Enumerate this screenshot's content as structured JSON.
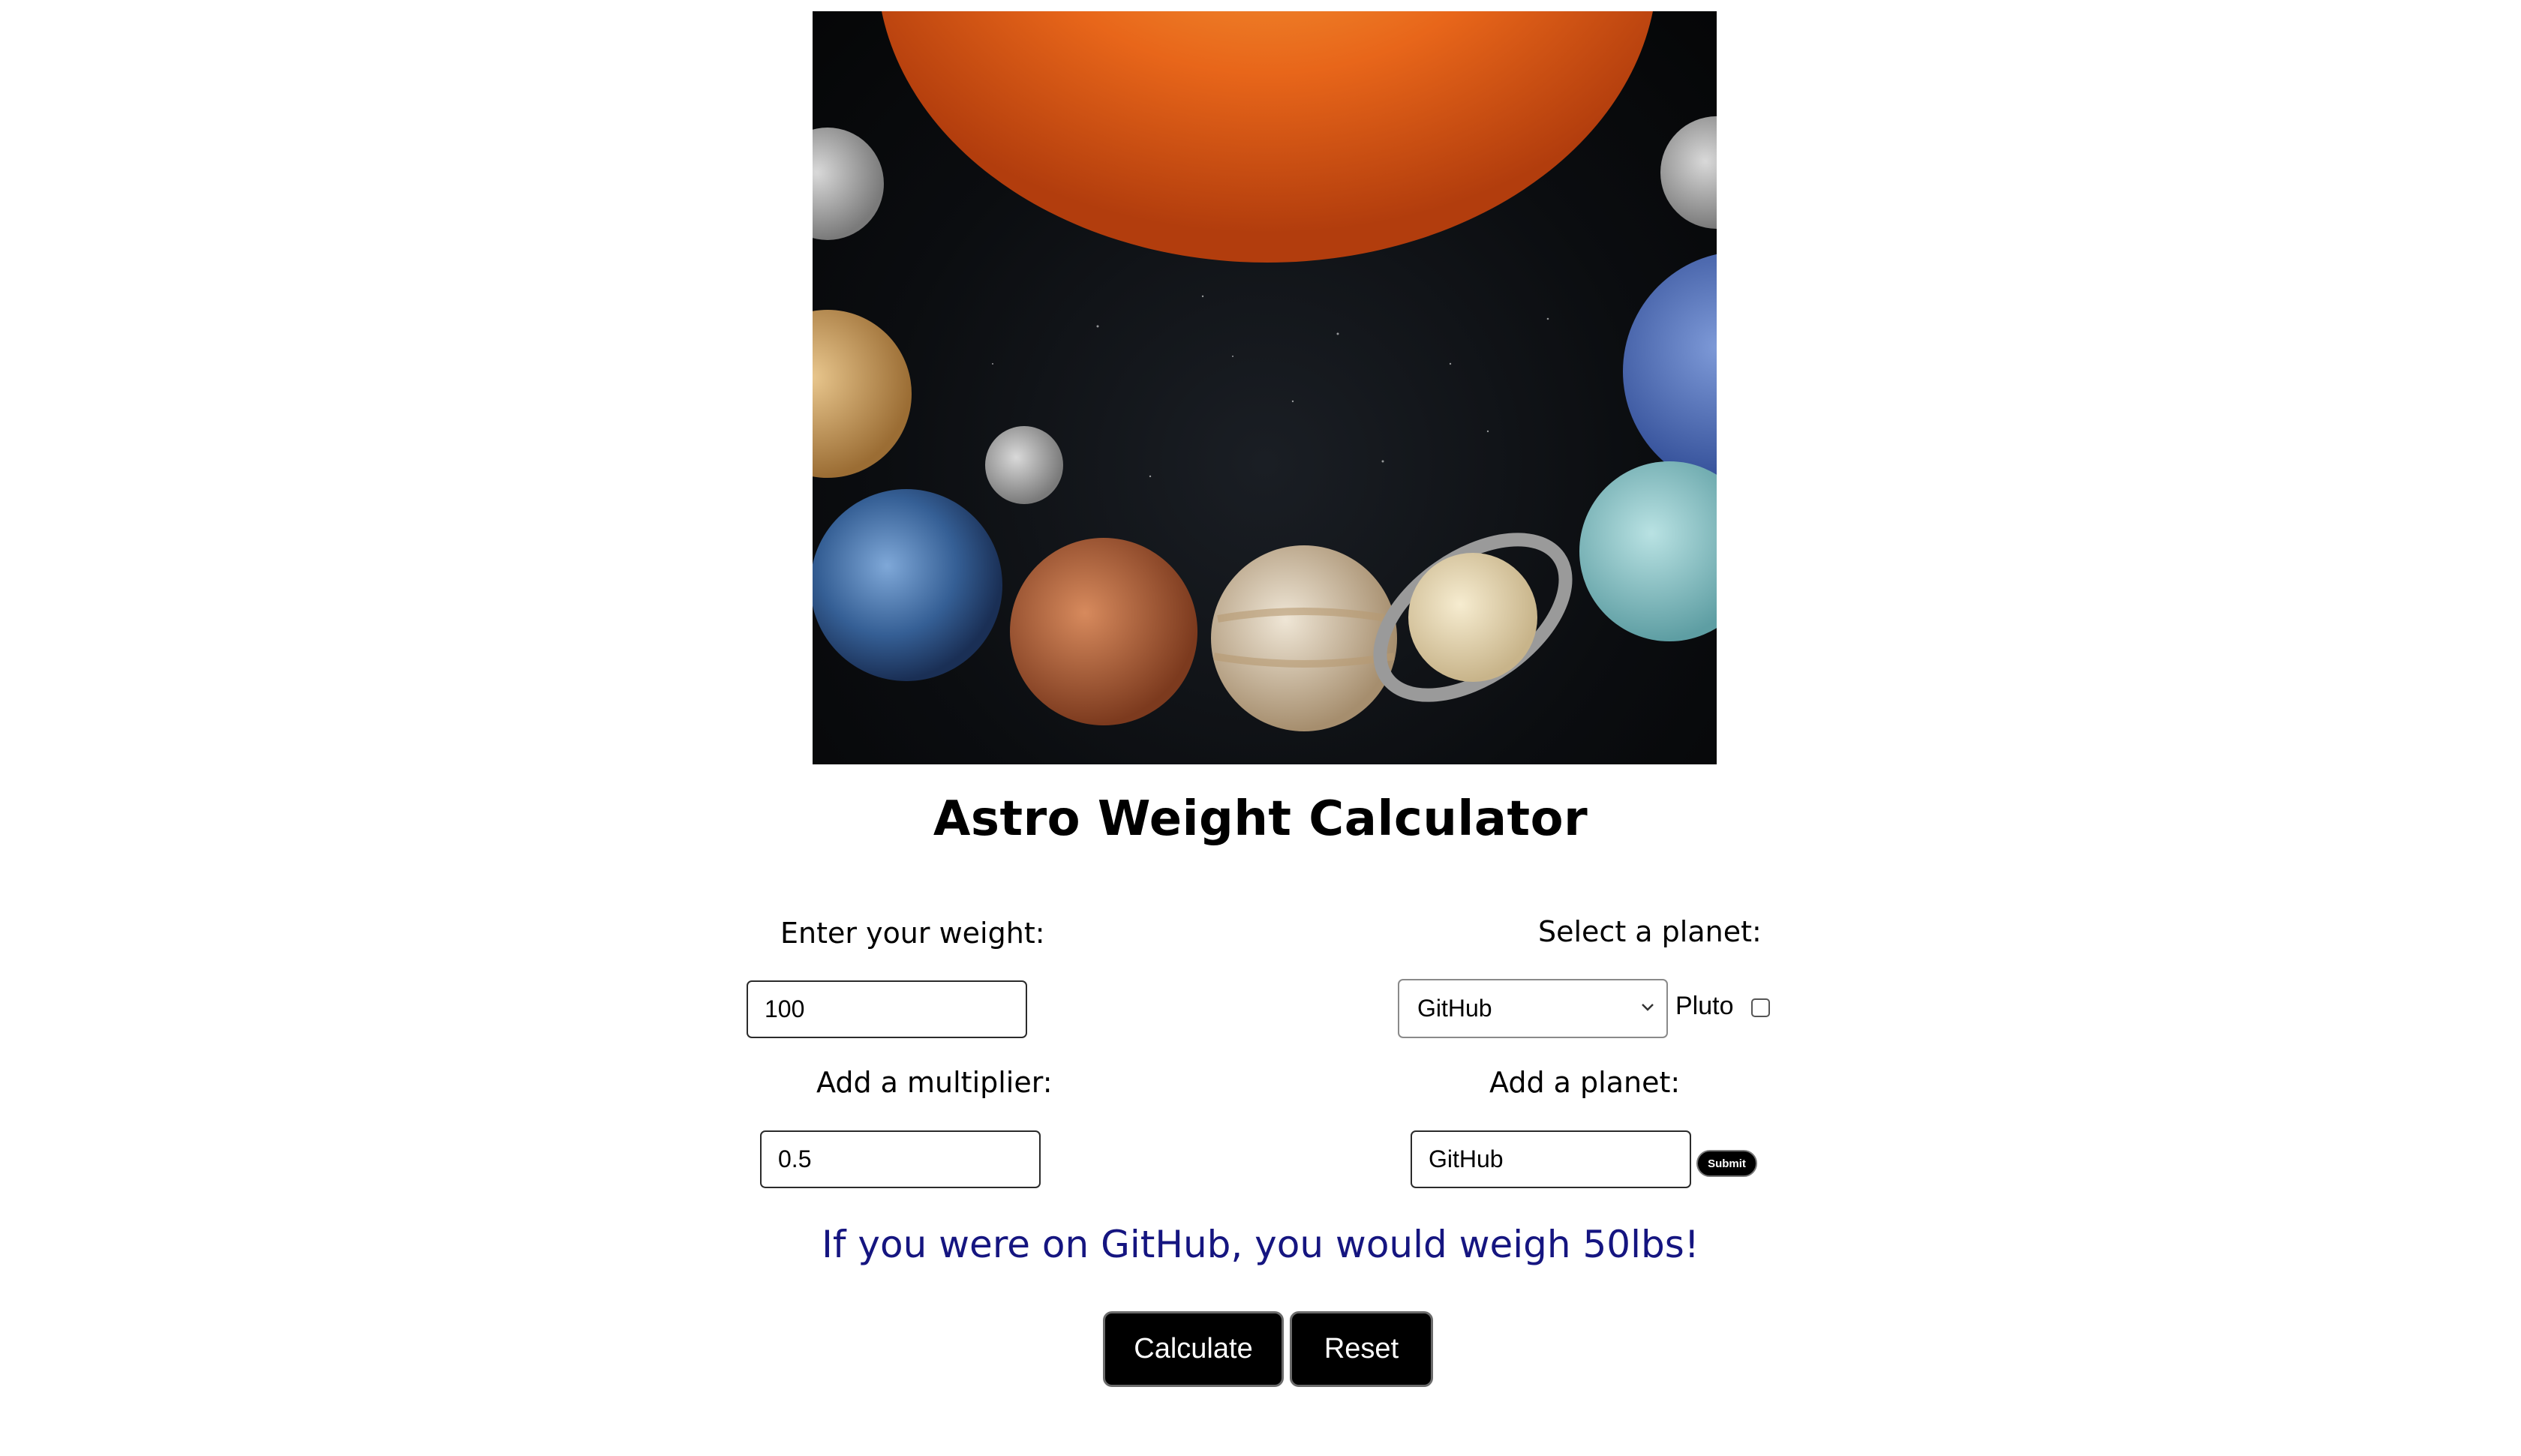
{
  "header": {
    "title": "Astro Weight Calculator"
  },
  "hero": {
    "image_name": "solar-system-image"
  },
  "weight": {
    "label": "Enter your weight:",
    "value": "100"
  },
  "multiplier": {
    "label": "Add a multiplier:",
    "value": "0.5"
  },
  "planet_select": {
    "label": "Select a planet:",
    "selected": "GitHub",
    "pluto_label": "Pluto",
    "pluto_checked": false
  },
  "add_planet": {
    "label": "Add a planet:",
    "value": "GitHub",
    "submit_label": "Submit"
  },
  "result": {
    "text": "If you were on GitHub, you would weigh 50lbs!",
    "color": "#151580"
  },
  "actions": {
    "calculate_label": "Calculate",
    "reset_label": "Reset"
  }
}
